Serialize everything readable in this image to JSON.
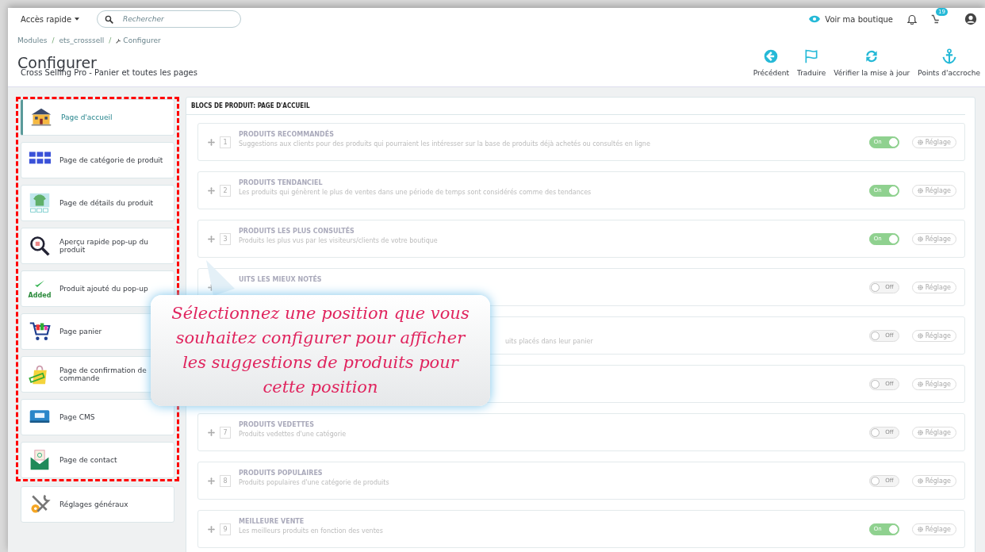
{
  "topbar": {
    "quick_access": "Accès rapide",
    "search": {
      "placeholder": "Rechercher"
    },
    "shop_link": "Voir ma boutique",
    "cart_badge": "19"
  },
  "breadcrumbs": [
    {
      "label": "Modules",
      "kind": "plain"
    },
    {
      "label": "/",
      "kind": "separator"
    },
    {
      "label": "ets_crosssell",
      "kind": "plain"
    },
    {
      "label": "/",
      "kind": "separator"
    },
    {
      "label": "Configurer",
      "kind": "wrench"
    }
  ],
  "page": {
    "title": "Configurer",
    "subtitle": "Cross Selling Pro - Panier et toutes les pages"
  },
  "toolbar": [
    {
      "label": "Précédent",
      "kind": "back"
    },
    {
      "label": "Traduire",
      "kind": "flag"
    },
    {
      "label": "Vérifier la mise à jour",
      "kind": "refresh"
    },
    {
      "label": "Points d'accroche",
      "kind": "anchor"
    }
  ],
  "sidebar": {
    "items": [
      {
        "label": "Page d'accueil",
        "kind": "house",
        "selected": true
      },
      {
        "label": "Page de catégorie de produit",
        "kind": "grid",
        "selected": false
      },
      {
        "label": "Page de détails du produit",
        "kind": "shirt",
        "selected": false
      },
      {
        "label": "Aperçu rapide pop-up du produit",
        "kind": "magnifier",
        "selected": false
      },
      {
        "label": "Produit ajouté du pop-up",
        "kind": "added",
        "icon_text": "Added",
        "selected": false
      },
      {
        "label": "Page panier",
        "kind": "cart",
        "selected": false
      },
      {
        "label": "Page de confirmation de commande",
        "kind": "bag",
        "selected": false
      },
      {
        "label": "Page CMS",
        "kind": "cms",
        "selected": false
      },
      {
        "label": "Page de contact",
        "kind": "mail",
        "selected": false
      }
    ],
    "footer_item": {
      "label": "Réglages généraux",
      "kind": "tools",
      "selected": false
    }
  },
  "panel": {
    "heading": "BLOCS DE PRODUIT: PAGE D'ACCUEIL",
    "rows": [
      {
        "number": "1",
        "title": "PRODUITS RECOMMANDÉS",
        "description": "Suggestions aux clients pour des produits qui pourraient les intéresser sur la base de produits déjà achetés ou consultés en ligne",
        "on": true,
        "toggle_label": "On",
        "settings": "Réglage"
      },
      {
        "number": "2",
        "title": "PRODUITS TENDANCIEL",
        "description": "Les produits qui génèrent le plus de ventes dans une période de temps sont considérés comme des tendances",
        "on": true,
        "toggle_label": "On",
        "settings": "Réglage"
      },
      {
        "number": "3",
        "title": "PRODUITS LES PLUS CONSULTÉS",
        "description": "Produits les plus vus par les visiteurs/clients de votre boutique",
        "on": true,
        "toggle_label": "On",
        "settings": "Réglage"
      },
      {
        "title": "UITS LES MIEUX NOTÉS",
        "on": false,
        "toggle_label": "Off",
        "settings": "Réglage"
      },
      {
        "description": "uits placés dans leur panier",
        "covered": true,
        "on": false,
        "toggle_label": "Off",
        "settings": "Réglage"
      },
      {
        "on": false,
        "toggle_label": "Off",
        "settings": "Réglage"
      },
      {
        "number": "7",
        "title": "PRODUITS VEDETTES",
        "description": "Produits vedettes d'une catégorie",
        "on": false,
        "toggle_label": "Off",
        "settings": "Réglage"
      },
      {
        "number": "8",
        "title": "PRODUITS POPULAIRES",
        "description": "Produits populaires d'une catégorie de produits",
        "on": false,
        "toggle_label": "Off",
        "settings": "Réglage"
      },
      {
        "number": "9",
        "title": "MEILLEURE VENTE",
        "description": "Les meilleurs produits en fonction des ventes",
        "on": true,
        "toggle_label": "On",
        "settings": "Réglage"
      }
    ]
  },
  "callout": {
    "text": "Sélectionnez une position que vous souhaitez configurer pour afficher les suggestions de produits pour cette position"
  }
}
